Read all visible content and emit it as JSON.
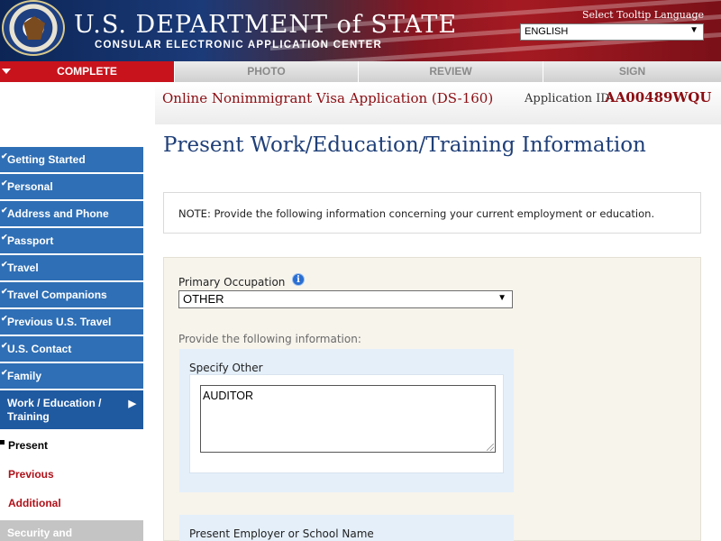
{
  "header": {
    "dept_title": "U.S. DEPARTMENT of STATE",
    "dept_subtitle": "CONSULAR ELECTRONIC APPLICATION CENTER",
    "tooltip_language_label": "Select Tooltip Language",
    "language_value": "ENGLISH"
  },
  "steps": [
    {
      "label": "COMPLETE",
      "active": true
    },
    {
      "label": "PHOTO",
      "active": false
    },
    {
      "label": "REVIEW",
      "active": false
    },
    {
      "label": "SIGN",
      "active": false
    }
  ],
  "app": {
    "title": "Online Nonimmigrant Visa Application (DS-160)",
    "id_label": "Application ID",
    "id_value": "AA00489WQU"
  },
  "sidebar": {
    "items": [
      {
        "label": "Getting Started"
      },
      {
        "label": "Personal"
      },
      {
        "label": "Address and Phone"
      },
      {
        "label": "Passport"
      },
      {
        "label": "Travel"
      },
      {
        "label": "Travel Companions"
      },
      {
        "label": "Previous U.S. Travel"
      },
      {
        "label": "U.S. Contact"
      },
      {
        "label": "Family"
      }
    ],
    "current": {
      "label": "Work / Education / Training"
    },
    "sub_items": [
      {
        "label": "Present"
      },
      {
        "label": "Previous"
      },
      {
        "label": "Additional"
      }
    ],
    "next": {
      "label": "Security and"
    }
  },
  "main": {
    "page_title": "Present Work/Education/Training Information",
    "note": "NOTE: Provide the following information concerning your current employment or education.",
    "primary_occupation_label": "Primary Occupation",
    "primary_occupation_value": "OTHER",
    "provide_info_label": "Provide the following information:",
    "specify_other_label": "Specify Other",
    "specify_other_value": "AUDITOR",
    "employer_label": "Present Employer or School Name"
  },
  "colors": {
    "accent_red": "#c8131c",
    "nav_blue": "#2f6fb5",
    "title_navy": "#1f3f78"
  }
}
